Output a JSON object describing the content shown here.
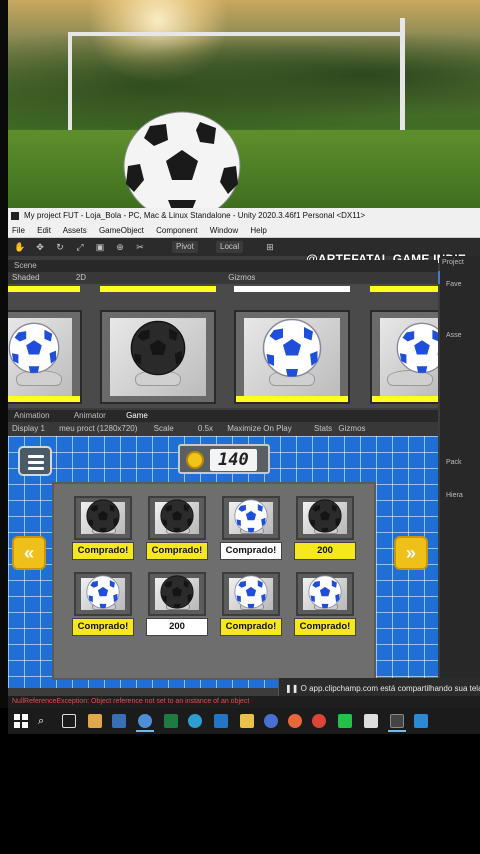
{
  "photo": {
    "description_hidden": ""
  },
  "unity": {
    "title": "My project FUT - Loja_Bola - PC, Mac & Linux Standalone - Unity 2020.3.46f1 Personal <DX11>",
    "menu": [
      "File",
      "Edit",
      "Assets",
      "GameObject",
      "Component",
      "Window",
      "Help"
    ],
    "toolbar": {
      "pivot": "Pivot",
      "local": "Local"
    },
    "watermark": "@ARTEFATAL.GAME.INDIE",
    "scene_tab": "Scene",
    "scene_shading": "Shaded",
    "scene_mode": "2D",
    "gizmos": "Gizmos",
    "game_tabs": [
      "Animation",
      "Animator",
      "Game"
    ],
    "game_toolbar": {
      "display": "Display 1",
      "resolution": "meu proct (1280x720)",
      "scale_label": "Scale",
      "scale_value": "0.5x",
      "maximize": "Maximize On Play",
      "stats": "Stats",
      "gizmos": "Gizmos"
    },
    "right_panel": {
      "project": "Project",
      "favorites": "Fave",
      "assets": "Asse",
      "packages": "Pack",
      "hierarchy": "Hiera"
    }
  },
  "game": {
    "coins": "140",
    "slots": [
      {
        "ball": "black",
        "label": "Comprado!",
        "style": "owned"
      },
      {
        "ball": "black",
        "label": "Comprado!",
        "style": "owned"
      },
      {
        "ball": "blue",
        "label": "Comprado!",
        "style": "selected"
      },
      {
        "ball": "black",
        "label": "200",
        "style": "price"
      },
      {
        "ball": "blue",
        "label": "Comprado!",
        "style": "owned"
      },
      {
        "ball": "black",
        "label": "200",
        "style": "selected"
      },
      {
        "ball": "blue",
        "label": "Comprado!",
        "style": "owned"
      },
      {
        "ball": "blue",
        "label": "Comprado!",
        "style": "owned"
      }
    ],
    "prev_label": "«",
    "next_label": "»"
  },
  "status": "NullReferenceException: Object reference not set to an instance of an object",
  "share_notice": "O app.clipchamp.com está compartilhando sua tela"
}
